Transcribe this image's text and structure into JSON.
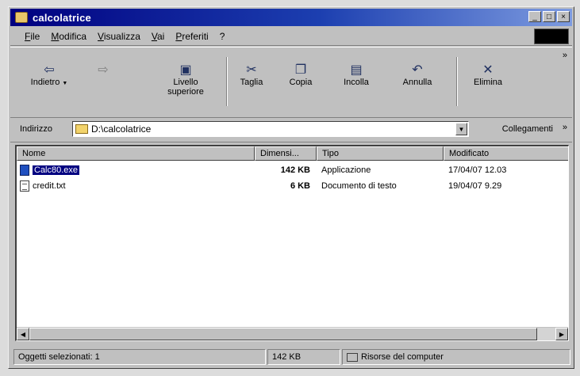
{
  "window": {
    "title": "calcolatrice",
    "controls": {
      "minimize": "_",
      "maximize": "□",
      "close": "×"
    }
  },
  "menu": [
    "File",
    "Modifica",
    "Visualizza",
    "Vai",
    "Preferiti",
    "?"
  ],
  "toolbar": {
    "back": {
      "label": "Indietro",
      "icon": "back-arrow-icon",
      "dropdown": "▼"
    },
    "forward": {
      "label": "",
      "icon": "forward-arrow-icon"
    },
    "up": {
      "label": "Livello superiore",
      "icon": "up-folder-icon"
    },
    "cut": {
      "label": "Taglia",
      "icon": "scissors-icon"
    },
    "copy": {
      "label": "Copia",
      "icon": "copy-icon"
    },
    "paste": {
      "label": "Incolla",
      "icon": "paste-icon"
    },
    "undo": {
      "label": "Annulla",
      "icon": "undo-icon"
    },
    "delete": {
      "label": "Elimina",
      "icon": "delete-icon"
    },
    "more": "»"
  },
  "address": {
    "label": "Indirizzo",
    "value": "D:\\calcolatrice",
    "links": "Collegamenti",
    "links_more": "»"
  },
  "files": {
    "columns": [
      "Nome",
      "Dimensi...",
      "Tipo",
      "Modificato"
    ],
    "rows": [
      {
        "name": "Calc80.exe",
        "size": "142 KB",
        "type": "Applicazione",
        "modified": "17/04/07 12.03",
        "icon": "exe-icon",
        "selected": true
      },
      {
        "name": "credit.txt",
        "size": "6 KB",
        "type": "Documento di testo",
        "modified": "19/04/07 9.29",
        "icon": "text-file-icon",
        "selected": false
      }
    ]
  },
  "status": {
    "selected": "Oggetti selezionati: 1",
    "size": "142 KB",
    "location": "Risorse del computer"
  }
}
